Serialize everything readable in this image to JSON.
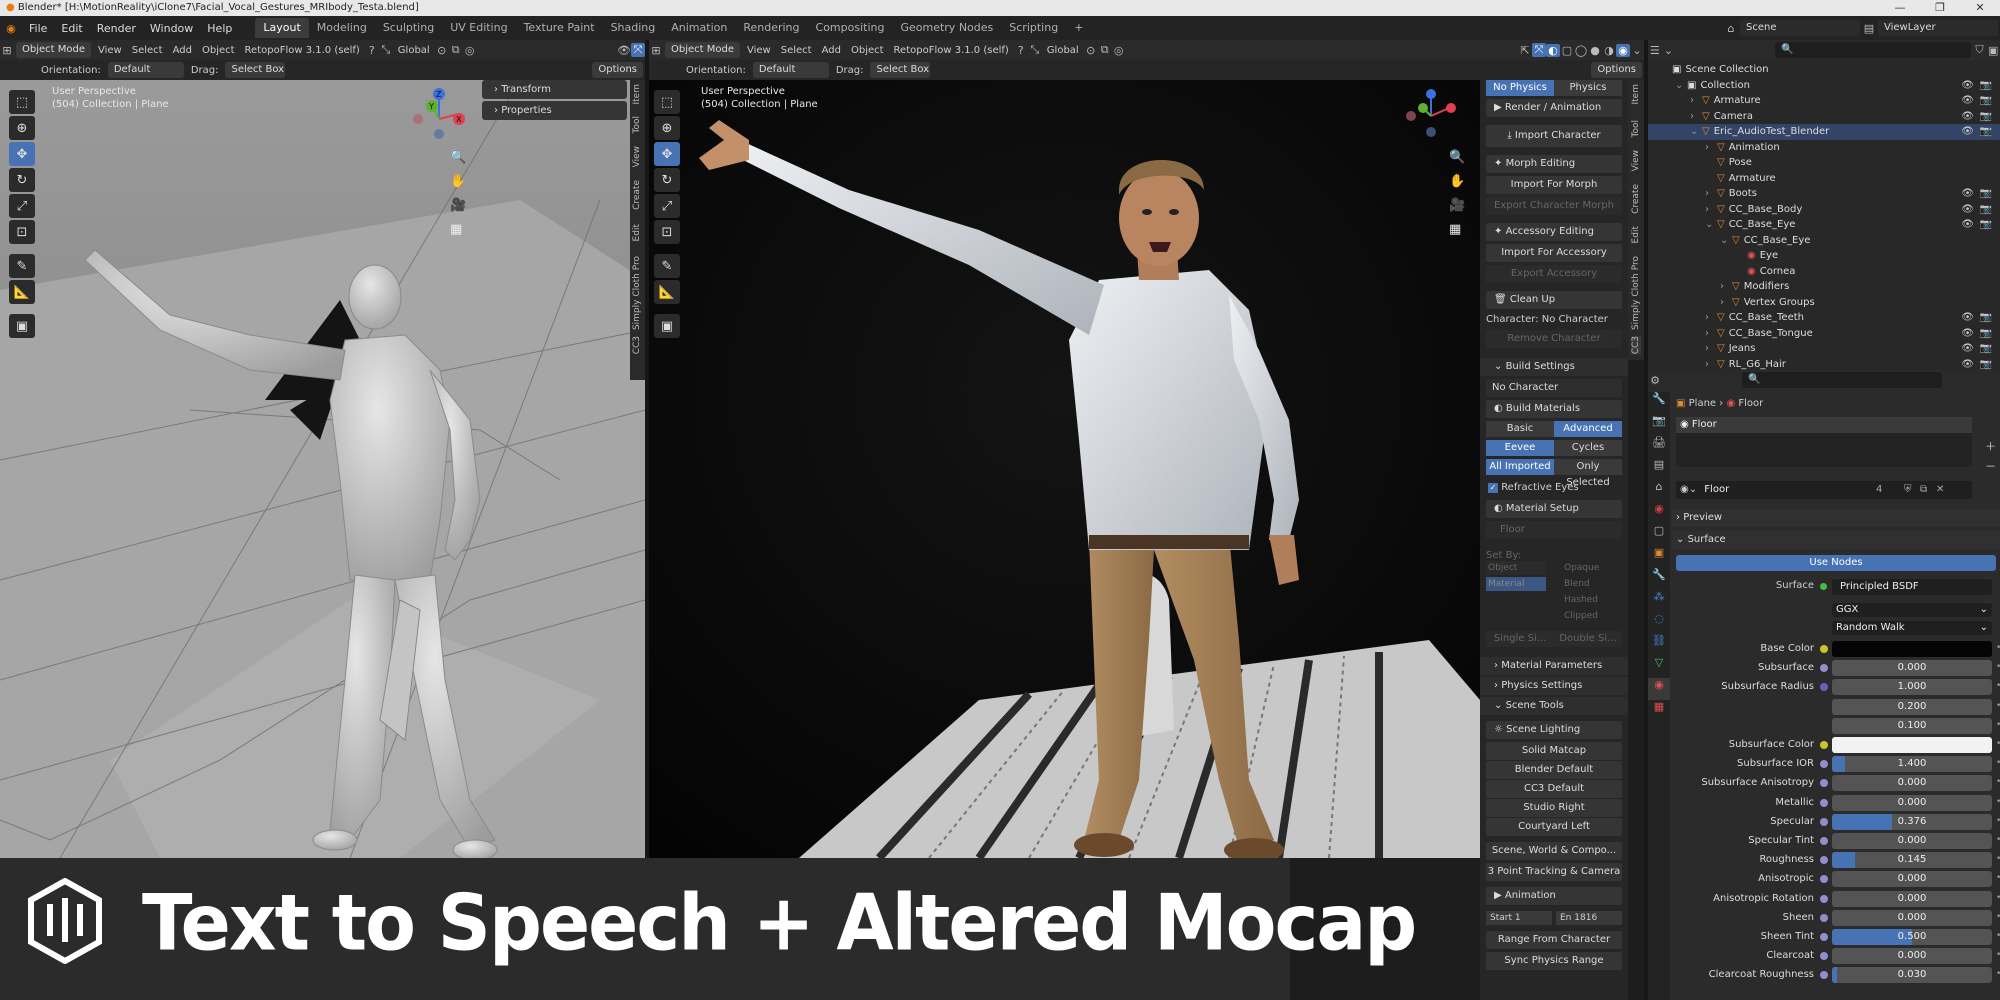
{
  "window": {
    "title": "Blender* [H:\\MotionReality\\iClone7\\Facial_Vocal_Gestures_MRIbody_Testa.blend]",
    "min": "—",
    "max": "❐",
    "close": "✕"
  },
  "menu": [
    "File",
    "Edit",
    "Render",
    "Window",
    "Help"
  ],
  "workspaces": [
    "Layout",
    "Modeling",
    "Sculpting",
    "UV Editing",
    "Texture Paint",
    "Shading",
    "Animation",
    "Rendering",
    "Compositing",
    "Geometry Nodes",
    "Scripting",
    "+"
  ],
  "workspace_active": "Layout",
  "scene": {
    "label": "Scene",
    "viewlayer": "ViewLayer"
  },
  "viewport_left": {
    "mode": "Object Mode",
    "view": "View",
    "select": "Select",
    "add": "Add",
    "object": "Object",
    "addon": "RetopoFlow 3.1.0 (self)",
    "transform": "Global",
    "orientation_label": "Orientation:",
    "orientation": "Default",
    "drag_label": "Drag:",
    "drag": "Select Box",
    "options": "Options",
    "perspective": "User Perspective",
    "collection": "(504) Collection | Plane",
    "panels": [
      "Transform",
      "Properties"
    ],
    "tabs": [
      "Item",
      "Tool",
      "View",
      "Create",
      "Edit",
      "Simply Cloth Pro",
      "CC3"
    ],
    "gizmo": {
      "z": "Z",
      "y": "Y",
      "x": "X"
    }
  },
  "viewport_right": {
    "mode": "Object Mode",
    "view": "View",
    "select": "Select",
    "add": "Add",
    "object": "Object",
    "addon": "RetopoFlow 3.1.0 (self)",
    "transform": "Global",
    "orientation_label": "Orientation:",
    "orientation": "Default",
    "drag_label": "Drag:",
    "drag": "Select Box",
    "options": "Options",
    "perspective": "User Perspective",
    "collection": "(504) Collection | Plane",
    "tabs": [
      "Item",
      "Tool",
      "View",
      "Create",
      "Edit",
      "Simply Cloth Pro",
      "CC3"
    ]
  },
  "cc3": {
    "physics_tabs": [
      "No Physics",
      "Physics"
    ],
    "render_anim": "Render / Animation",
    "import_character": "Import Character",
    "morph_editing": "Morph Editing",
    "import_for_morph": "Import For Morph",
    "export_character_morph": "Export Character Morph",
    "accessory_editing": "Accessory Editing",
    "import_for_accessory": "Import For Accessory",
    "export_accessory": "Export Accessory",
    "clean_up": "Clean Up",
    "character": "Character: No Character",
    "remove_character": "Remove Character",
    "build_settings": "Build Settings",
    "no_character": "No Character",
    "build_materials": "Build Materials",
    "basic": "Basic",
    "advanced": "Advanced",
    "eevee": "Eevee",
    "cycles": "Cycles",
    "all_imported": "All Imported",
    "only_selected": "Only Selected",
    "refractive_eyes": "Refractive Eyes",
    "material_setup": "Material Setup",
    "floor": "Floor",
    "set_by": "Set By:",
    "object": "Object",
    "material": "Material",
    "opaque": "Opaque",
    "blend": "Blend",
    "hashed": "Hashed",
    "clipped": "Clipped",
    "single_sided": "Single Si...",
    "double_sided": "Double Si...",
    "material_parameters": "Material Parameters",
    "physics_settings": "Physics Settings",
    "scene_tools": "Scene Tools",
    "scene_lighting": "Scene Lighting",
    "lighting": [
      "Solid Matcap",
      "Blender Default",
      "CC3 Default",
      "Studio Right",
      "Courtyard Left"
    ],
    "scene_world": "Scene, World & Compo...",
    "tracking": "3 Point Tracking & Camera",
    "animation": "Animation",
    "start_label": "Start",
    "start": "1",
    "end_label": "En",
    "end": "1816",
    "range_from_character": "Range From Character",
    "sync_physics_range": "Sync Physics Range"
  },
  "outliner": {
    "items": [
      {
        "label": "Scene Collection",
        "depth": 0
      },
      {
        "label": "Collection",
        "depth": 1
      },
      {
        "label": "Armature",
        "depth": 2
      },
      {
        "label": "Camera",
        "depth": 2
      },
      {
        "label": "Eric_AudioTest_Blender",
        "depth": 2
      },
      {
        "label": "Animation",
        "depth": 3
      },
      {
        "label": "Pose",
        "depth": 3
      },
      {
        "label": "Armature",
        "depth": 3
      },
      {
        "label": "Boots",
        "depth": 3
      },
      {
        "label": "CC_Base_Body",
        "depth": 3
      },
      {
        "label": "CC_Base_Eye",
        "depth": 3
      },
      {
        "label": "CC_Base_Eye",
        "depth": 4
      },
      {
        "label": "Eye",
        "depth": 5
      },
      {
        "label": "Cornea",
        "depth": 5
      },
      {
        "label": "Modifiers",
        "depth": 4
      },
      {
        "label": "Vertex Groups",
        "depth": 4
      },
      {
        "label": "CC_Base_Teeth",
        "depth": 3
      },
      {
        "label": "CC_Base_Tongue",
        "depth": 3
      },
      {
        "label": "Jeans",
        "depth": 3
      },
      {
        "label": "RL_G6_Hair",
        "depth": 3
      }
    ]
  },
  "properties": {
    "breadcrumb": [
      "Plane",
      "Floor"
    ],
    "slot": "Floor",
    "material": "Floor",
    "users": "4",
    "preview": "Preview",
    "surface_section": "Surface",
    "use_nodes": "Use Nodes",
    "surface_label": "Surface",
    "surface_value": "Principled BSDF",
    "distribution": "GGX",
    "subsurface_method": "Random Walk",
    "rows": [
      {
        "label": "Base Color",
        "value": "",
        "kind": "color",
        "color": "#050505"
      },
      {
        "label": "Subsurface",
        "value": "0.000",
        "fill": 0
      },
      {
        "label": "Subsurface Radius",
        "value": "1.000",
        "fill": 0
      },
      {
        "label": "",
        "value": "0.200",
        "fill": 0
      },
      {
        "label": "",
        "value": "0.100",
        "fill": 0
      },
      {
        "label": "Subsurface Color",
        "value": "",
        "kind": "color",
        "color": "#f2f2f2"
      },
      {
        "label": "Subsurface IOR",
        "value": "1.400",
        "fill": 0.08
      },
      {
        "label": "Subsurface Anisotropy",
        "value": "0.000",
        "fill": 0
      },
      {
        "label": "Metallic",
        "value": "0.000",
        "fill": 0
      },
      {
        "label": "Specular",
        "value": "0.376",
        "fill": 0.376
      },
      {
        "label": "Specular Tint",
        "value": "0.000",
        "fill": 0
      },
      {
        "label": "Roughness",
        "value": "0.145",
        "fill": 0.145
      },
      {
        "label": "Anisotropic",
        "value": "0.000",
        "fill": 0
      },
      {
        "label": "Anisotropic Rotation",
        "value": "0.000",
        "fill": 0
      },
      {
        "label": "Sheen",
        "value": "0.000",
        "fill": 0
      },
      {
        "label": "Sheen Tint",
        "value": "0.500",
        "fill": 0.5
      },
      {
        "label": "Clearcoat",
        "value": "0.000",
        "fill": 0
      },
      {
        "label": "Clearcoat Roughness",
        "value": "0.030",
        "fill": 0.03
      }
    ]
  },
  "banner": {
    "text": "Text to Speech + Altered Mocap"
  },
  "colors": {
    "accent": "#4772b3",
    "header": "#2a2a2a",
    "panel": "#303030"
  }
}
